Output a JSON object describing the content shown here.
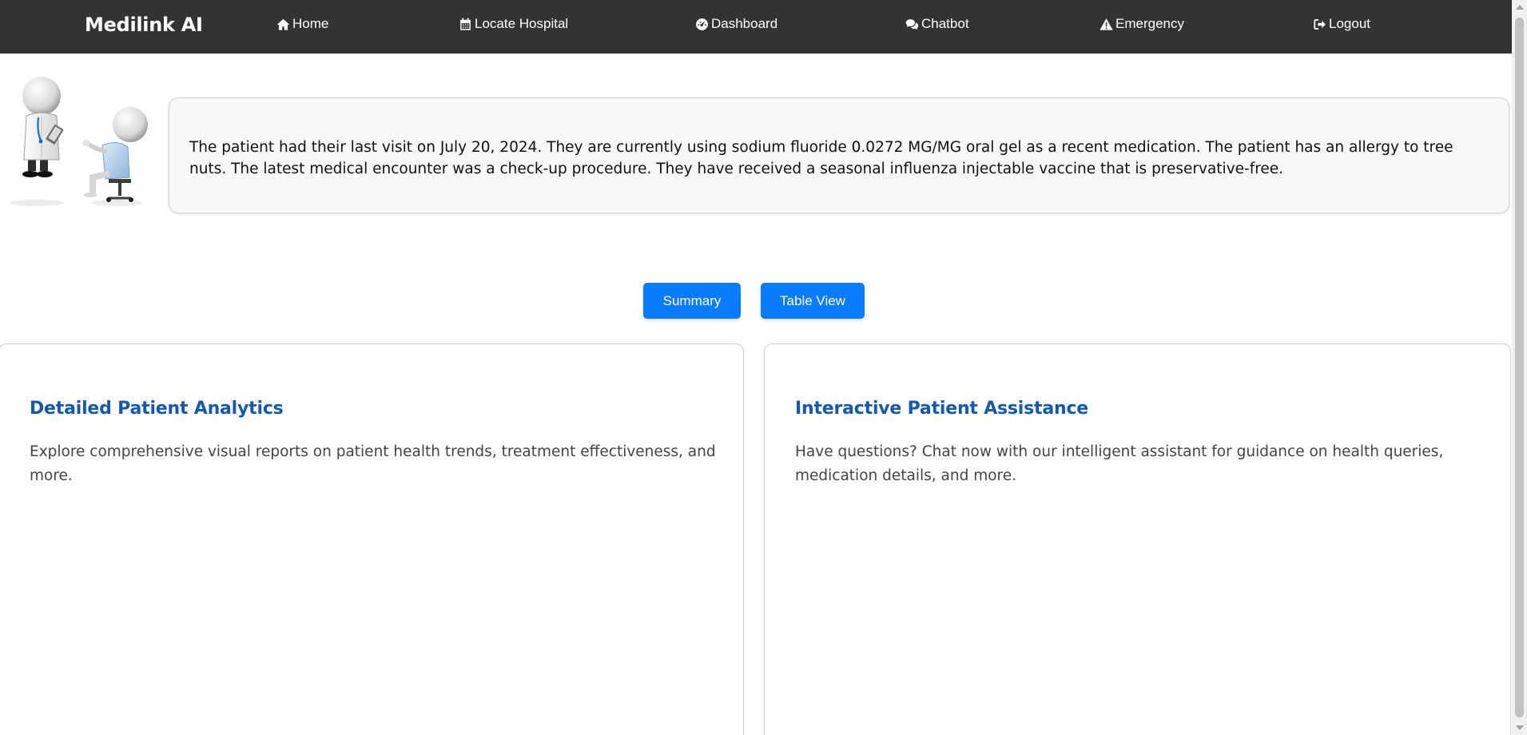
{
  "app": {
    "brand": "Medilink AI"
  },
  "nav": {
    "items": [
      {
        "label": "Home",
        "icon": "home-icon"
      },
      {
        "label": "Locate Hospital",
        "icon": "calendar-icon"
      },
      {
        "label": "Dashboard",
        "icon": "dashboard-gauge-icon"
      },
      {
        "label": "Chatbot",
        "icon": "chat-bubbles-icon"
      },
      {
        "label": "Emergency",
        "icon": "warning-icon"
      },
      {
        "label": "Logout",
        "icon": "logout-icon"
      }
    ]
  },
  "summary": {
    "text": "The patient had their last visit on July 20, 2024. They are currently using sodium fluoride 0.0272 MG/MG oral gel as a recent medication. The patient has an allergy to tree nuts. The latest medical encounter was a check-up procedure. They have received a seasonal influenza injectable vaccine that is preservative-free."
  },
  "views": {
    "summary_label": "Summary",
    "table_label": "Table View"
  },
  "cards": [
    {
      "title": "Detailed Patient Analytics",
      "description": "Explore comprehensive visual reports on patient health trends, treatment effectiveness, and more."
    },
    {
      "title": "Interactive Patient Assistance",
      "description": "Have questions? Chat now with our intelligent assistant for guidance on health queries, medication details, and more."
    }
  ],
  "colors": {
    "navbar": "#333333",
    "primary_button": "#0a7cff",
    "card_title": "#1558b0",
    "summary_bg": "#f8f8f8"
  }
}
